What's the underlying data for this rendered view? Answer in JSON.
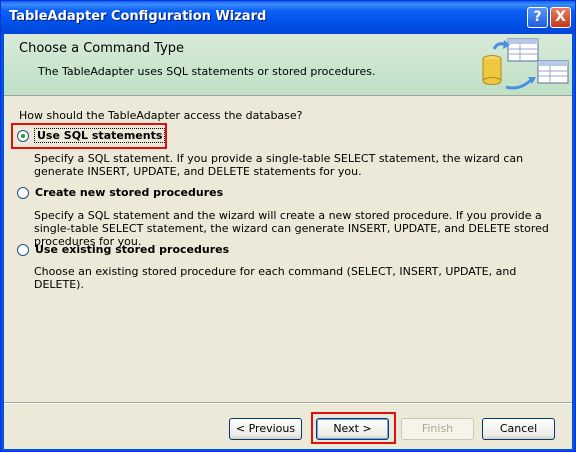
{
  "window": {
    "title": "TableAdapter Configuration Wizard",
    "help_glyph": "?",
    "close_glyph": "X"
  },
  "header": {
    "title": "Choose a Command Type",
    "subtitle": "The TableAdapter uses SQL statements or stored procedures."
  },
  "question": "How should the TableAdapter access the database?",
  "options": [
    {
      "label": "Use SQL statements",
      "selected": true,
      "description": "Specify a SQL statement. If you provide a single-table SELECT statement, the wizard can generate INSERT, UPDATE, and DELETE statements for you."
    },
    {
      "label": "Create new stored procedures",
      "selected": false,
      "description": "Specify a SQL statement and the wizard will create a new stored procedure. If you provide a single-table SELECT statement, the wizard can generate INSERT, UPDATE, and DELETE stored procedures for you."
    },
    {
      "label": "Use existing stored procedures",
      "selected": false,
      "description": "Choose an existing stored procedure for each command (SELECT, INSERT, UPDATE, and DELETE)."
    }
  ],
  "buttons": {
    "previous": "< Previous",
    "next": "Next >",
    "finish": "Finish",
    "cancel": "Cancel"
  },
  "colors": {
    "titlebar": "#0054e3",
    "header_bg": "#c8e4cc",
    "highlight": "#e01010",
    "radio_dot": "#21a121"
  }
}
